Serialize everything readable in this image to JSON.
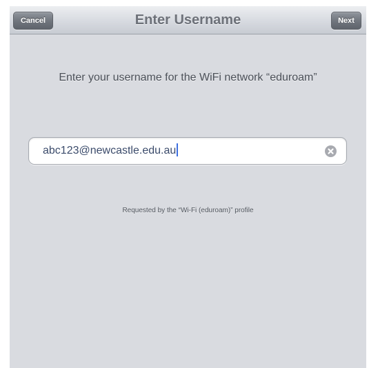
{
  "navbar": {
    "title": "Enter Username",
    "cancel_label": "Cancel",
    "next_label": "Next"
  },
  "prompt": "Enter your username for the WiFi network “eduroam”",
  "username_field": {
    "value": "abc123@newcastle.edu.au",
    "clear_icon": "clear-x-circle-icon"
  },
  "footnote": "Requested by the “Wi-Fi (eduroam)” profile",
  "colors": {
    "background": "#d9dbe0",
    "caret": "#3c6ee0",
    "button": "#6f747c"
  }
}
